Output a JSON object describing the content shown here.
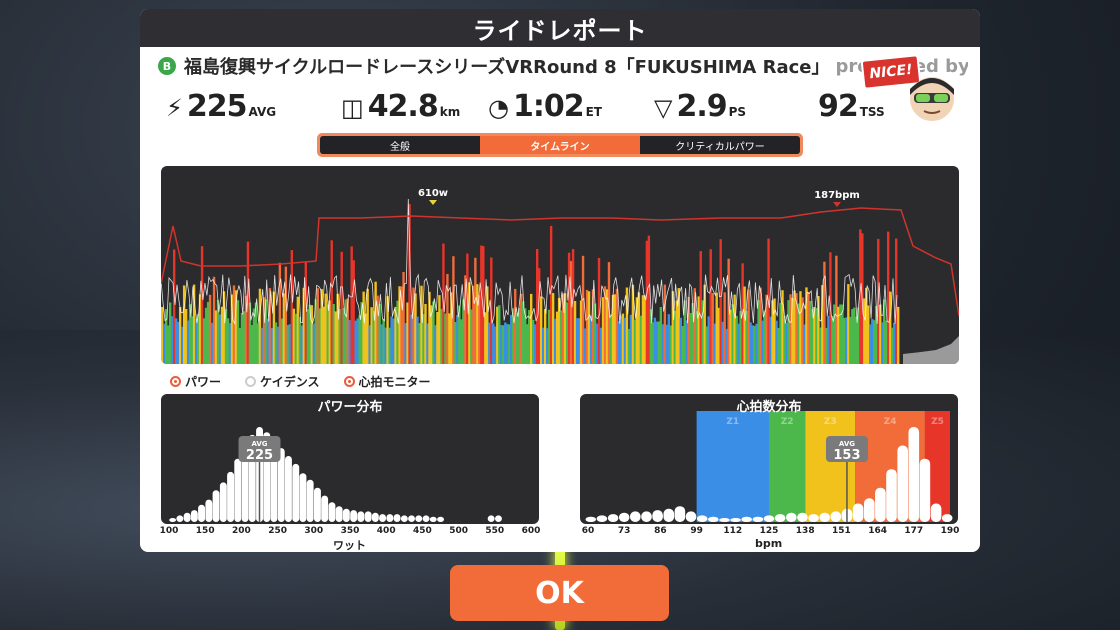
{
  "header": {
    "title": "ライドレポート"
  },
  "ride": {
    "category": "B",
    "name": "福島復興サイクルロードレースシリーズVRRound 8「FUKUSHIMA Race」",
    "name_suffix": "presented by ZEAL"
  },
  "stats": [
    {
      "icon": "power-icon",
      "glyph": "⚡",
      "value": "225",
      "unit": "AVG"
    },
    {
      "icon": "odometer-icon",
      "glyph": "◫",
      "value": "42.8",
      "unit": "km"
    },
    {
      "icon": "clock-icon",
      "glyph": "◔",
      "value": "1:02",
      "unit": "ET"
    },
    {
      "icon": "pizza-icon",
      "glyph": "▽",
      "value": "2.9",
      "unit": "PS"
    },
    {
      "icon": "tss-icon",
      "glyph": "",
      "value": "92",
      "unit": "TSS"
    }
  ],
  "badge": {
    "label": "NICE!"
  },
  "tabs": [
    {
      "label": "全般",
      "active": false
    },
    {
      "label": "タイムライン",
      "active": true
    },
    {
      "label": "クリティカルパワー",
      "active": false
    }
  ],
  "timeline": {
    "peak_power_label": "610w",
    "peak_hr_label": "187bpm"
  },
  "legend": [
    {
      "label": "パワー",
      "on": true
    },
    {
      "label": "ケイデンス",
      "on": false
    },
    {
      "label": "心拍モニター",
      "on": true
    }
  ],
  "colors": {
    "accent": "#f26c3a",
    "zone1": "#888888",
    "zone2": "#3a8ee6",
    "zone3": "#4cb84c",
    "zone4": "#f2c21c",
    "zone5": "#f26c3a",
    "zone6": "#e8352a"
  },
  "chart_data": [
    {
      "type": "bar",
      "title": "パワー分布",
      "xlabel": "ワット",
      "x_ticks": [
        "100",
        "150",
        "200",
        "250",
        "300",
        "350",
        "400",
        "450",
        "500",
        "550",
        "600"
      ],
      "xlim": [
        100,
        600
      ],
      "avg_label": "AVG",
      "avg_value": "225",
      "avg_x": 225,
      "bins": [
        {
          "x": 105,
          "v": 3
        },
        {
          "x": 115,
          "v": 5
        },
        {
          "x": 125,
          "v": 7
        },
        {
          "x": 135,
          "v": 9
        },
        {
          "x": 145,
          "v": 13
        },
        {
          "x": 155,
          "v": 17
        },
        {
          "x": 165,
          "v": 24
        },
        {
          "x": 175,
          "v": 30
        },
        {
          "x": 185,
          "v": 38
        },
        {
          "x": 195,
          "v": 48
        },
        {
          "x": 205,
          "v": 58
        },
        {
          "x": 215,
          "v": 66
        },
        {
          "x": 225,
          "v": 72
        },
        {
          "x": 235,
          "v": 68
        },
        {
          "x": 245,
          "v": 63
        },
        {
          "x": 255,
          "v": 56
        },
        {
          "x": 265,
          "v": 50
        },
        {
          "x": 275,
          "v": 44
        },
        {
          "x": 285,
          "v": 37
        },
        {
          "x": 295,
          "v": 32
        },
        {
          "x": 305,
          "v": 26
        },
        {
          "x": 315,
          "v": 20
        },
        {
          "x": 325,
          "v": 15
        },
        {
          "x": 335,
          "v": 12
        },
        {
          "x": 345,
          "v": 10
        },
        {
          "x": 355,
          "v": 9
        },
        {
          "x": 365,
          "v": 8
        },
        {
          "x": 375,
          "v": 8
        },
        {
          "x": 385,
          "v": 7
        },
        {
          "x": 395,
          "v": 6
        },
        {
          "x": 405,
          "v": 6
        },
        {
          "x": 415,
          "v": 6
        },
        {
          "x": 425,
          "v": 5
        },
        {
          "x": 435,
          "v": 5
        },
        {
          "x": 445,
          "v": 5
        },
        {
          "x": 455,
          "v": 5
        },
        {
          "x": 465,
          "v": 4
        },
        {
          "x": 475,
          "v": 4
        },
        {
          "x": 545,
          "v": 5
        },
        {
          "x": 555,
          "v": 5
        }
      ]
    },
    {
      "type": "bar",
      "title": "心拍数分布",
      "xlabel": "bpm",
      "x_ticks": [
        "60",
        "73",
        "86",
        "99",
        "112",
        "125",
        "138",
        "151",
        "164",
        "177",
        "190"
      ],
      "xlim": [
        60,
        190
      ],
      "avg_label": "AVG",
      "avg_value": "153",
      "avg_x": 153,
      "zones": [
        {
          "label": "Z1",
          "from": 99,
          "to": 125,
          "color": "#3a8ee6"
        },
        {
          "label": "Z2",
          "from": 125,
          "to": 138,
          "color": "#4cb84c"
        },
        {
          "label": "Z3",
          "from": 138,
          "to": 156,
          "color": "#f2c21c"
        },
        {
          "label": "Z4",
          "from": 156,
          "to": 181,
          "color": "#f26c3a"
        },
        {
          "label": "Z5",
          "from": 181,
          "to": 190,
          "color": "#e8352a"
        }
      ],
      "bins": [
        {
          "x": 61,
          "v": 4
        },
        {
          "x": 65,
          "v": 5
        },
        {
          "x": 69,
          "v": 6
        },
        {
          "x": 73,
          "v": 7
        },
        {
          "x": 77,
          "v": 8
        },
        {
          "x": 81,
          "v": 8
        },
        {
          "x": 85,
          "v": 9
        },
        {
          "x": 89,
          "v": 10
        },
        {
          "x": 93,
          "v": 12
        },
        {
          "x": 97,
          "v": 8
        },
        {
          "x": 101,
          "v": 5
        },
        {
          "x": 105,
          "v": 4
        },
        {
          "x": 109,
          "v": 3
        },
        {
          "x": 113,
          "v": 3
        },
        {
          "x": 117,
          "v": 4
        },
        {
          "x": 121,
          "v": 4
        },
        {
          "x": 125,
          "v": 5
        },
        {
          "x": 129,
          "v": 6
        },
        {
          "x": 133,
          "v": 7
        },
        {
          "x": 137,
          "v": 7
        },
        {
          "x": 141,
          "v": 6
        },
        {
          "x": 145,
          "v": 7
        },
        {
          "x": 149,
          "v": 8
        },
        {
          "x": 153,
          "v": 10
        },
        {
          "x": 157,
          "v": 14
        },
        {
          "x": 161,
          "v": 18
        },
        {
          "x": 165,
          "v": 26
        },
        {
          "x": 169,
          "v": 40
        },
        {
          "x": 173,
          "v": 58
        },
        {
          "x": 177,
          "v": 72
        },
        {
          "x": 181,
          "v": 48
        },
        {
          "x": 185,
          "v": 14
        },
        {
          "x": 189,
          "v": 6
        }
      ]
    }
  ]
}
